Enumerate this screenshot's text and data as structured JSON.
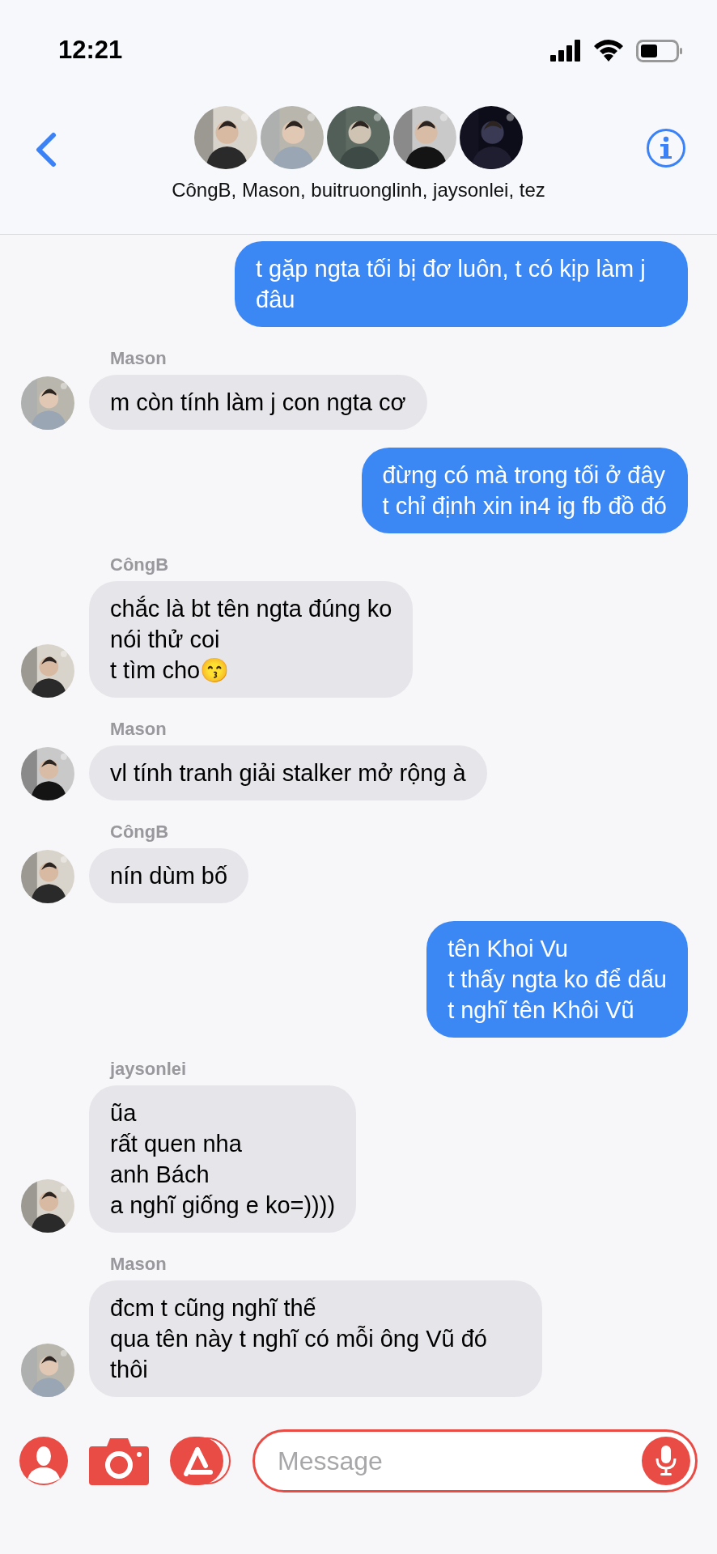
{
  "status_bar": {
    "time": "12:21"
  },
  "header": {
    "participants": "CôngB, Mason, buitruonglinh, jaysonlei, tez"
  },
  "messages": [
    {
      "kind": "sent",
      "text": "t gặp ngta tối bị đơ luôn, t có kịp làm j đâu"
    },
    {
      "kind": "received",
      "sender": "Mason",
      "text": "m còn tính làm j con ngta cơ"
    },
    {
      "kind": "sent",
      "text": "đừng có mà trong tối ở đây\nt chỉ định xin in4 ig fb đồ đó"
    },
    {
      "kind": "received",
      "sender": "CôngB",
      "text": "chắc là bt tên ngta đúng ko\nnói thử coi\nt tìm cho😙"
    },
    {
      "kind": "received",
      "sender": "Mason",
      "text": "vl tính tranh giải stalker mở rộng à"
    },
    {
      "kind": "received",
      "sender": "CôngB",
      "text": "nín dùm bố"
    },
    {
      "kind": "sent",
      "text": "tên Khoi Vu\nt thấy ngta ko để dấu\nt nghĩ tên Khôi Vũ"
    },
    {
      "kind": "received",
      "sender": "jaysonlei",
      "text": "ũa\nrất quen nha\nanh Bách\na nghĩ giống e ko=))))"
    },
    {
      "kind": "received",
      "sender": "Mason",
      "text": "đcm t cũng nghĩ thế\nqua tên này t nghĩ có mỗi ông Vũ đó thôi"
    }
  ],
  "composer": {
    "placeholder": "Message"
  }
}
